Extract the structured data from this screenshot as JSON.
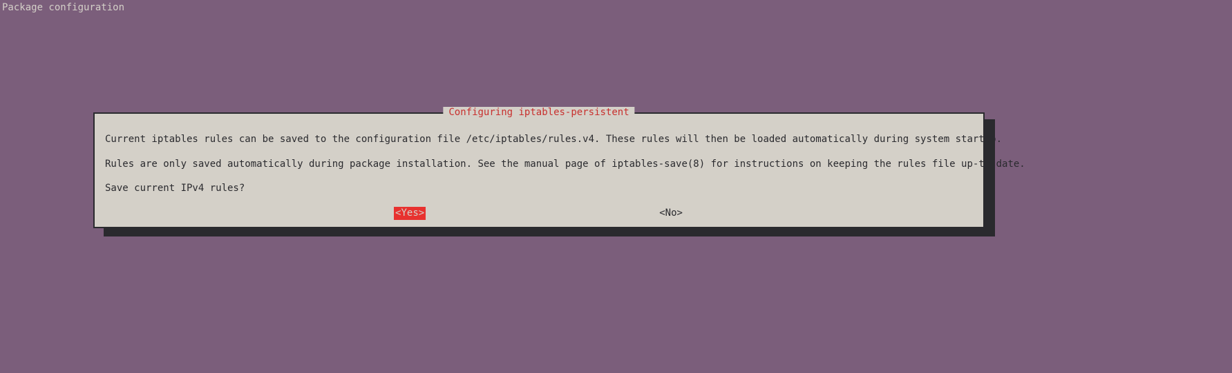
{
  "header": {
    "title": "Package configuration"
  },
  "dialog": {
    "title": "Configuring iptables-persistent",
    "line1": "Current iptables rules can be saved to the configuration file /etc/iptables/rules.v4. These rules will then be loaded automatically during system startup.",
    "line2": "Rules are only saved automatically during package installation. See the manual page of iptables-save(8) for instructions on keeping the rules file up-to-date.",
    "line3": "Save current IPv4 rules?",
    "buttons": {
      "yes": "<Yes>",
      "no": "<No>"
    }
  }
}
